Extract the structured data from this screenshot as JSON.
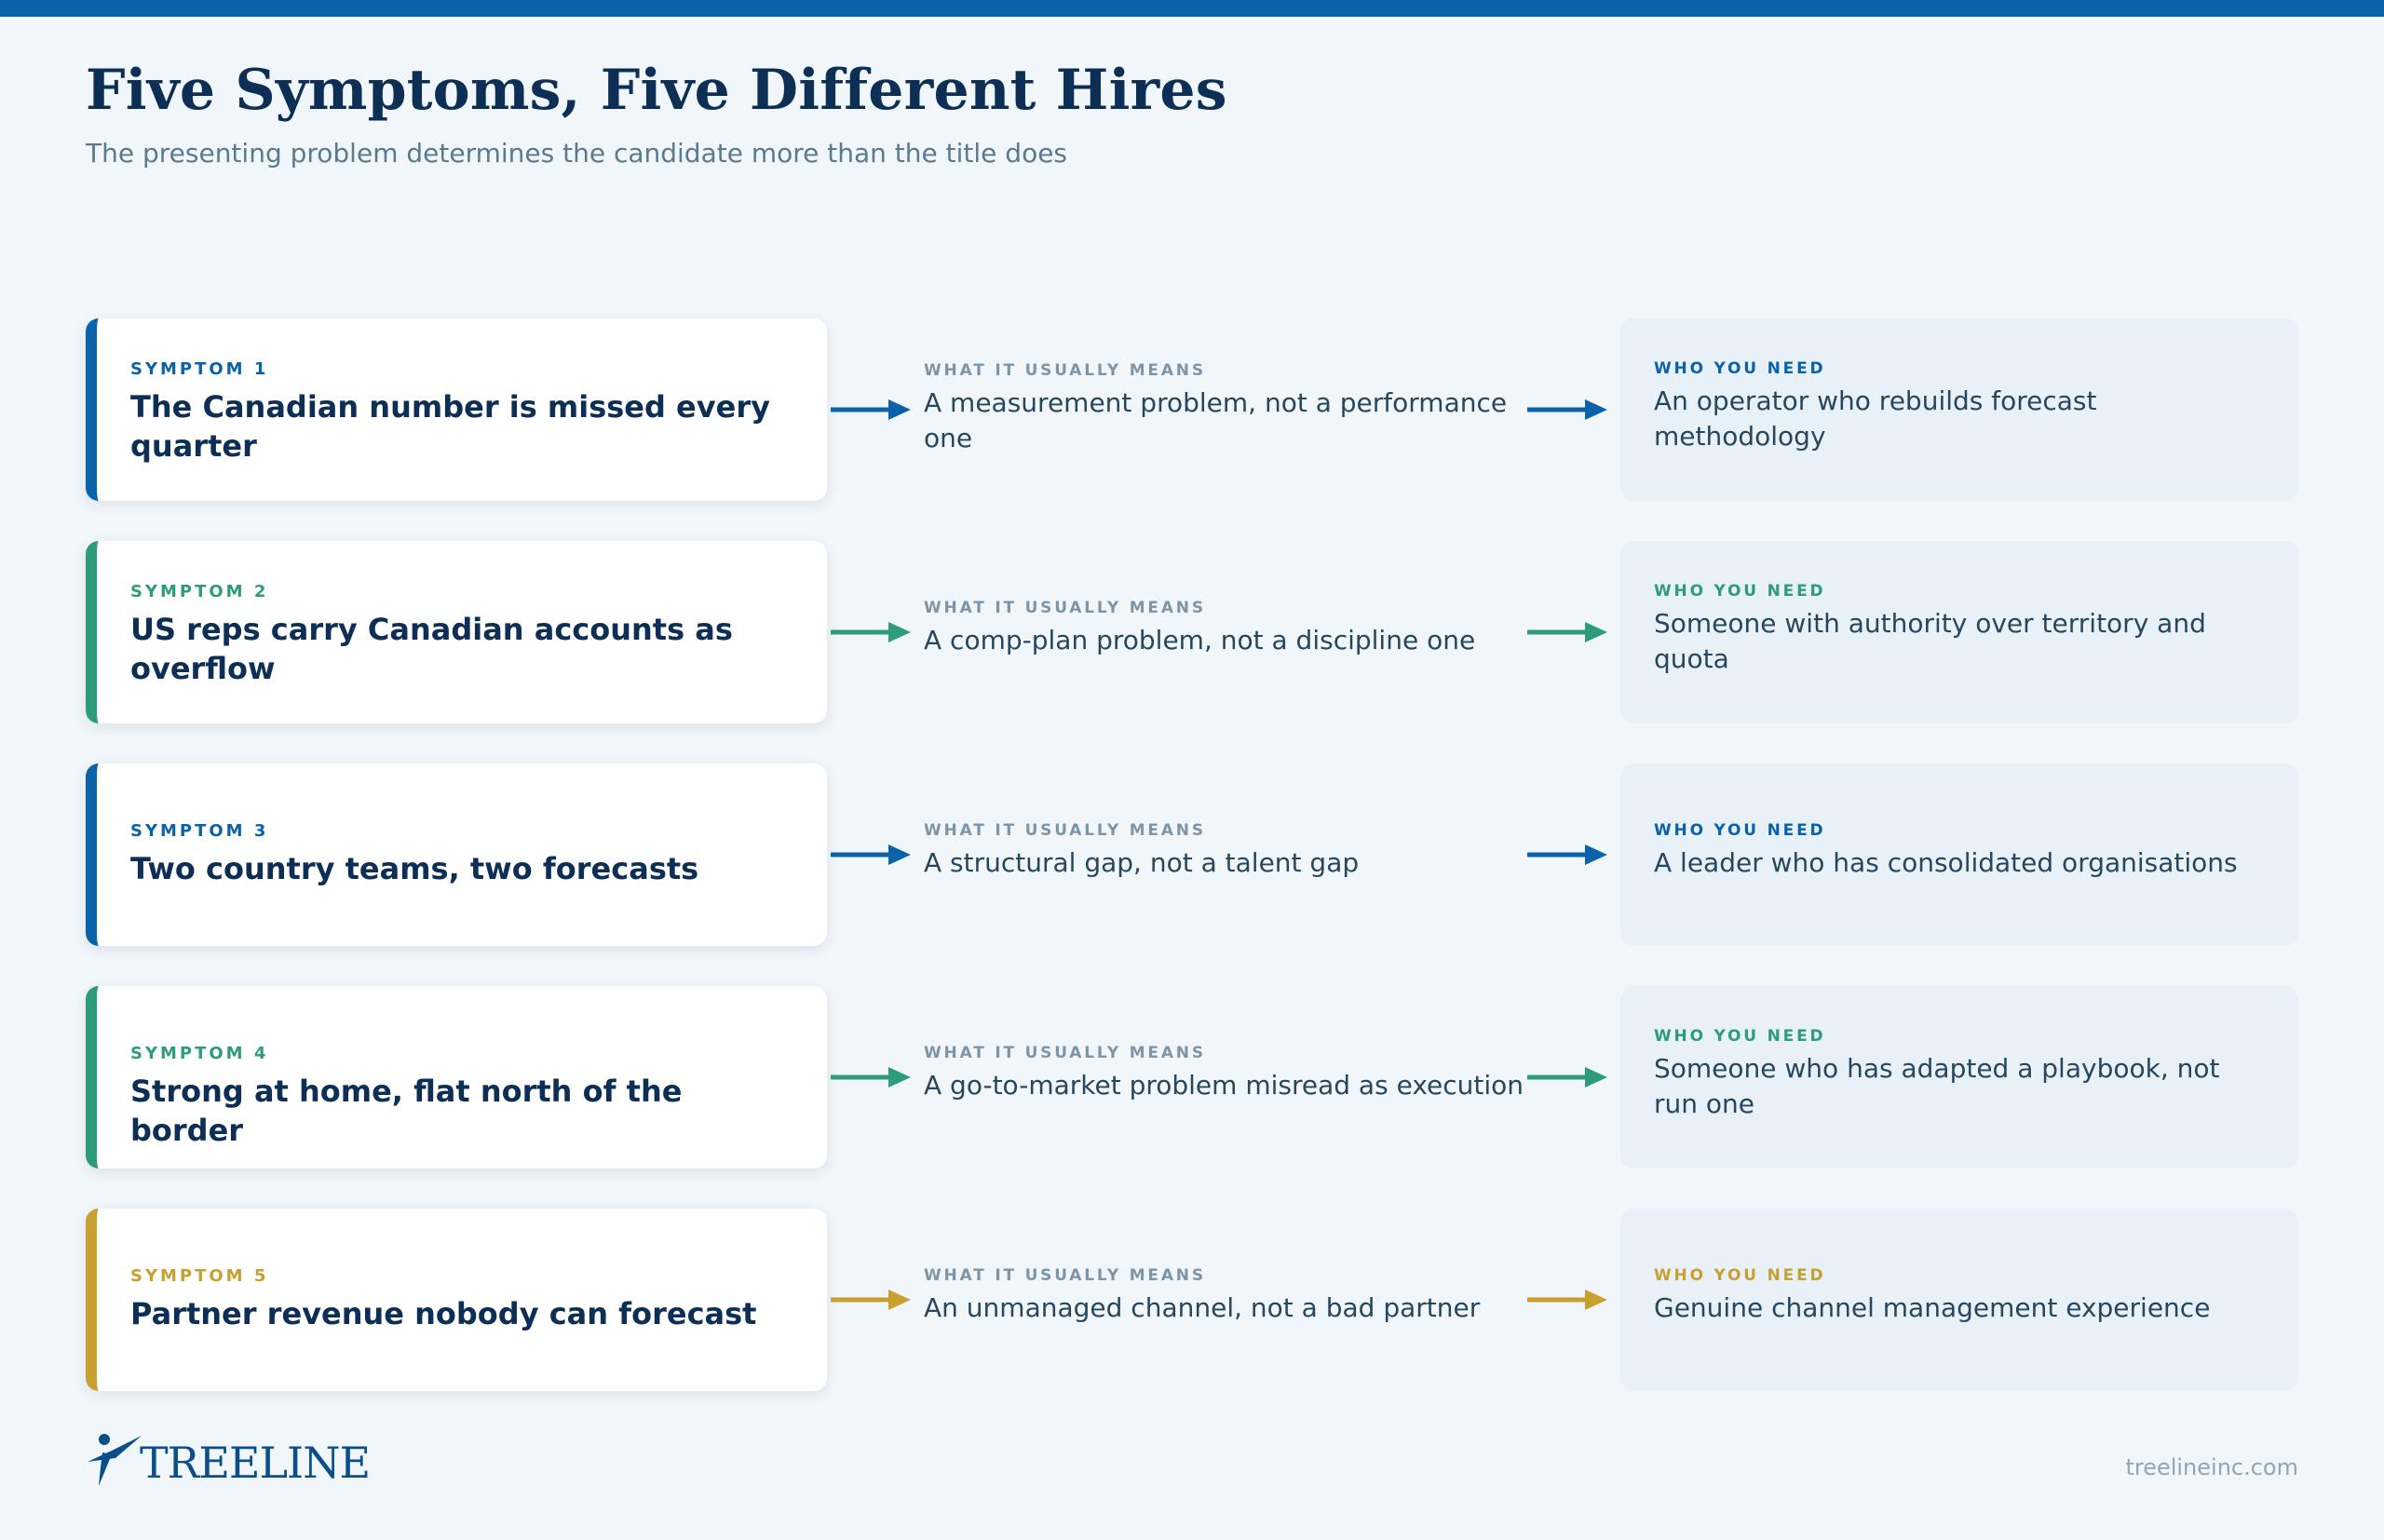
{
  "header": {
    "title": "Five Symptoms, Five Different Hires",
    "subtitle": "The presenting problem determines the candidate more than the title does"
  },
  "colors": {
    "blue": "#0a63a8",
    "green": "#2e9b7c",
    "gold": "#c9a030",
    "navy": "#0d2f55"
  },
  "mid_label": "WHAT IT USUALLY MEANS",
  "need_label": "WHO YOU NEED",
  "rows": [
    {
      "symptom_label": "SYMPTOM 1",
      "symptom": "The Canadian number is missed every quarter",
      "meaning": "A measurement problem, not a performance one",
      "who": "An operator who rebuilds forecast methodology",
      "color": "#0a63a8"
    },
    {
      "symptom_label": "SYMPTOM 2",
      "symptom": "US reps carry Canadian accounts as overflow",
      "meaning": "A comp-plan problem, not a discipline one",
      "who": "Someone with authority over territory and quota",
      "color": "#2e9b7c"
    },
    {
      "symptom_label": "SYMPTOM 3",
      "symptom": "Two country teams, two forecasts",
      "meaning": "A structural gap, not a talent gap",
      "who": "A leader who has consolidated organisations",
      "color": "#0a63a8"
    },
    {
      "symptom_label": "SYMPTOM 4",
      "symptom": "Strong at home, flat north of the border",
      "meaning": "A go-to-market problem misread as execution",
      "who": "Someone who has adapted a playbook, not run one",
      "color": "#2e9b7c"
    },
    {
      "symptom_label": "SYMPTOM 5",
      "symptom": "Partner revenue nobody can forecast",
      "meaning": "An unmanaged channel, not a bad partner",
      "who": "Genuine channel management experience",
      "color": "#c9a030"
    }
  ],
  "footer": {
    "logo_text": "TREELINE",
    "url": "treelineinc.com"
  }
}
